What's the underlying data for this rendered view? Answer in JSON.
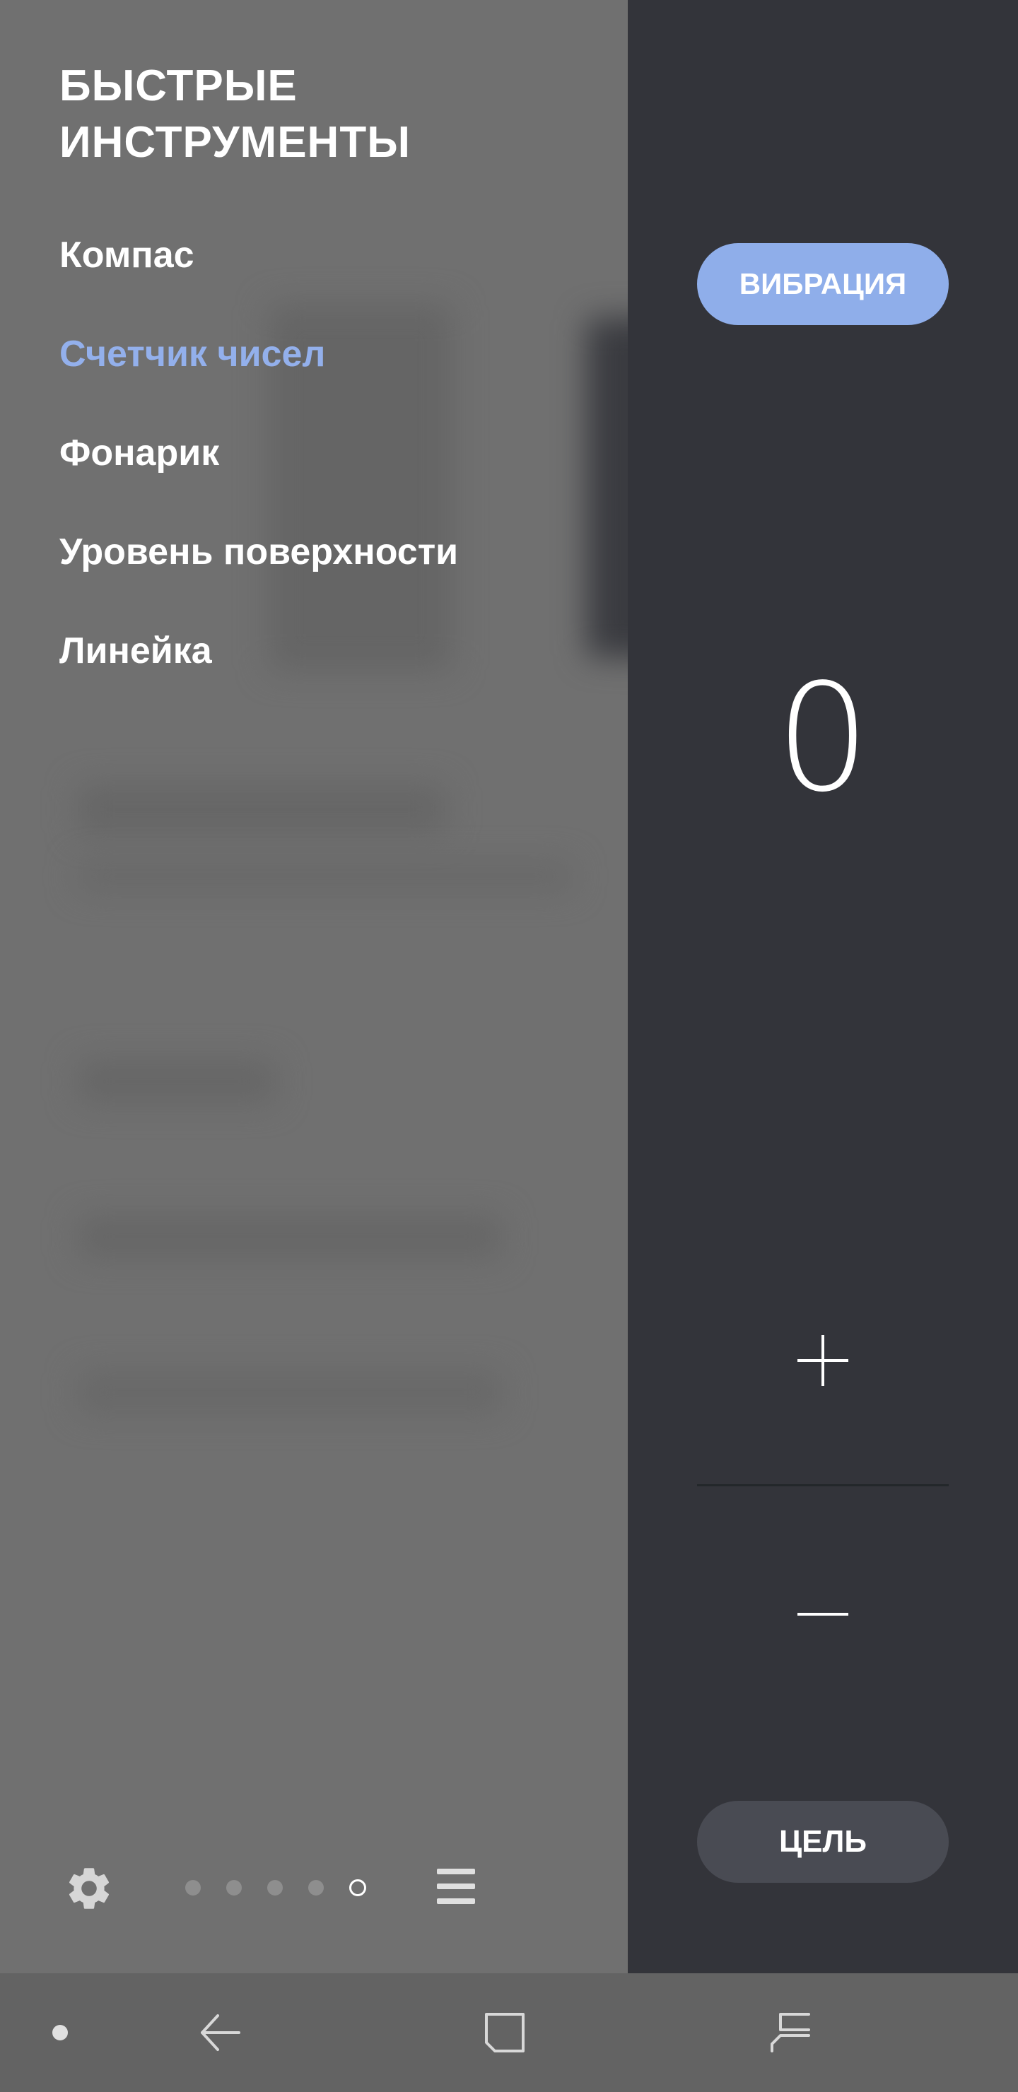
{
  "menu": {
    "title_line1": "БЫСТРЫЕ",
    "title_line2": "ИНСТРУМЕНТЫ",
    "items": [
      {
        "label": "Компас",
        "active": false
      },
      {
        "label": "Счетчик чисел",
        "active": true
      },
      {
        "label": "Фонарик",
        "active": false
      },
      {
        "label": "Уровень поверхности",
        "active": false
      },
      {
        "label": "Линейка",
        "active": false
      }
    ],
    "accent_color": "#93b0ec",
    "page_indicator": {
      "total": 5,
      "current": 5
    }
  },
  "counter": {
    "vibrate_label": "ВИБРАЦИЯ",
    "value": "0",
    "increment_icon": "plus-icon",
    "decrement_icon": "minus-icon",
    "target_label": "ЦЕЛЬ",
    "panel_color": "#33343a",
    "vibrate_color": "#8faeea"
  },
  "navbar": {
    "icons": [
      "dot-icon",
      "back-icon",
      "home-icon",
      "recents-icon"
    ]
  }
}
